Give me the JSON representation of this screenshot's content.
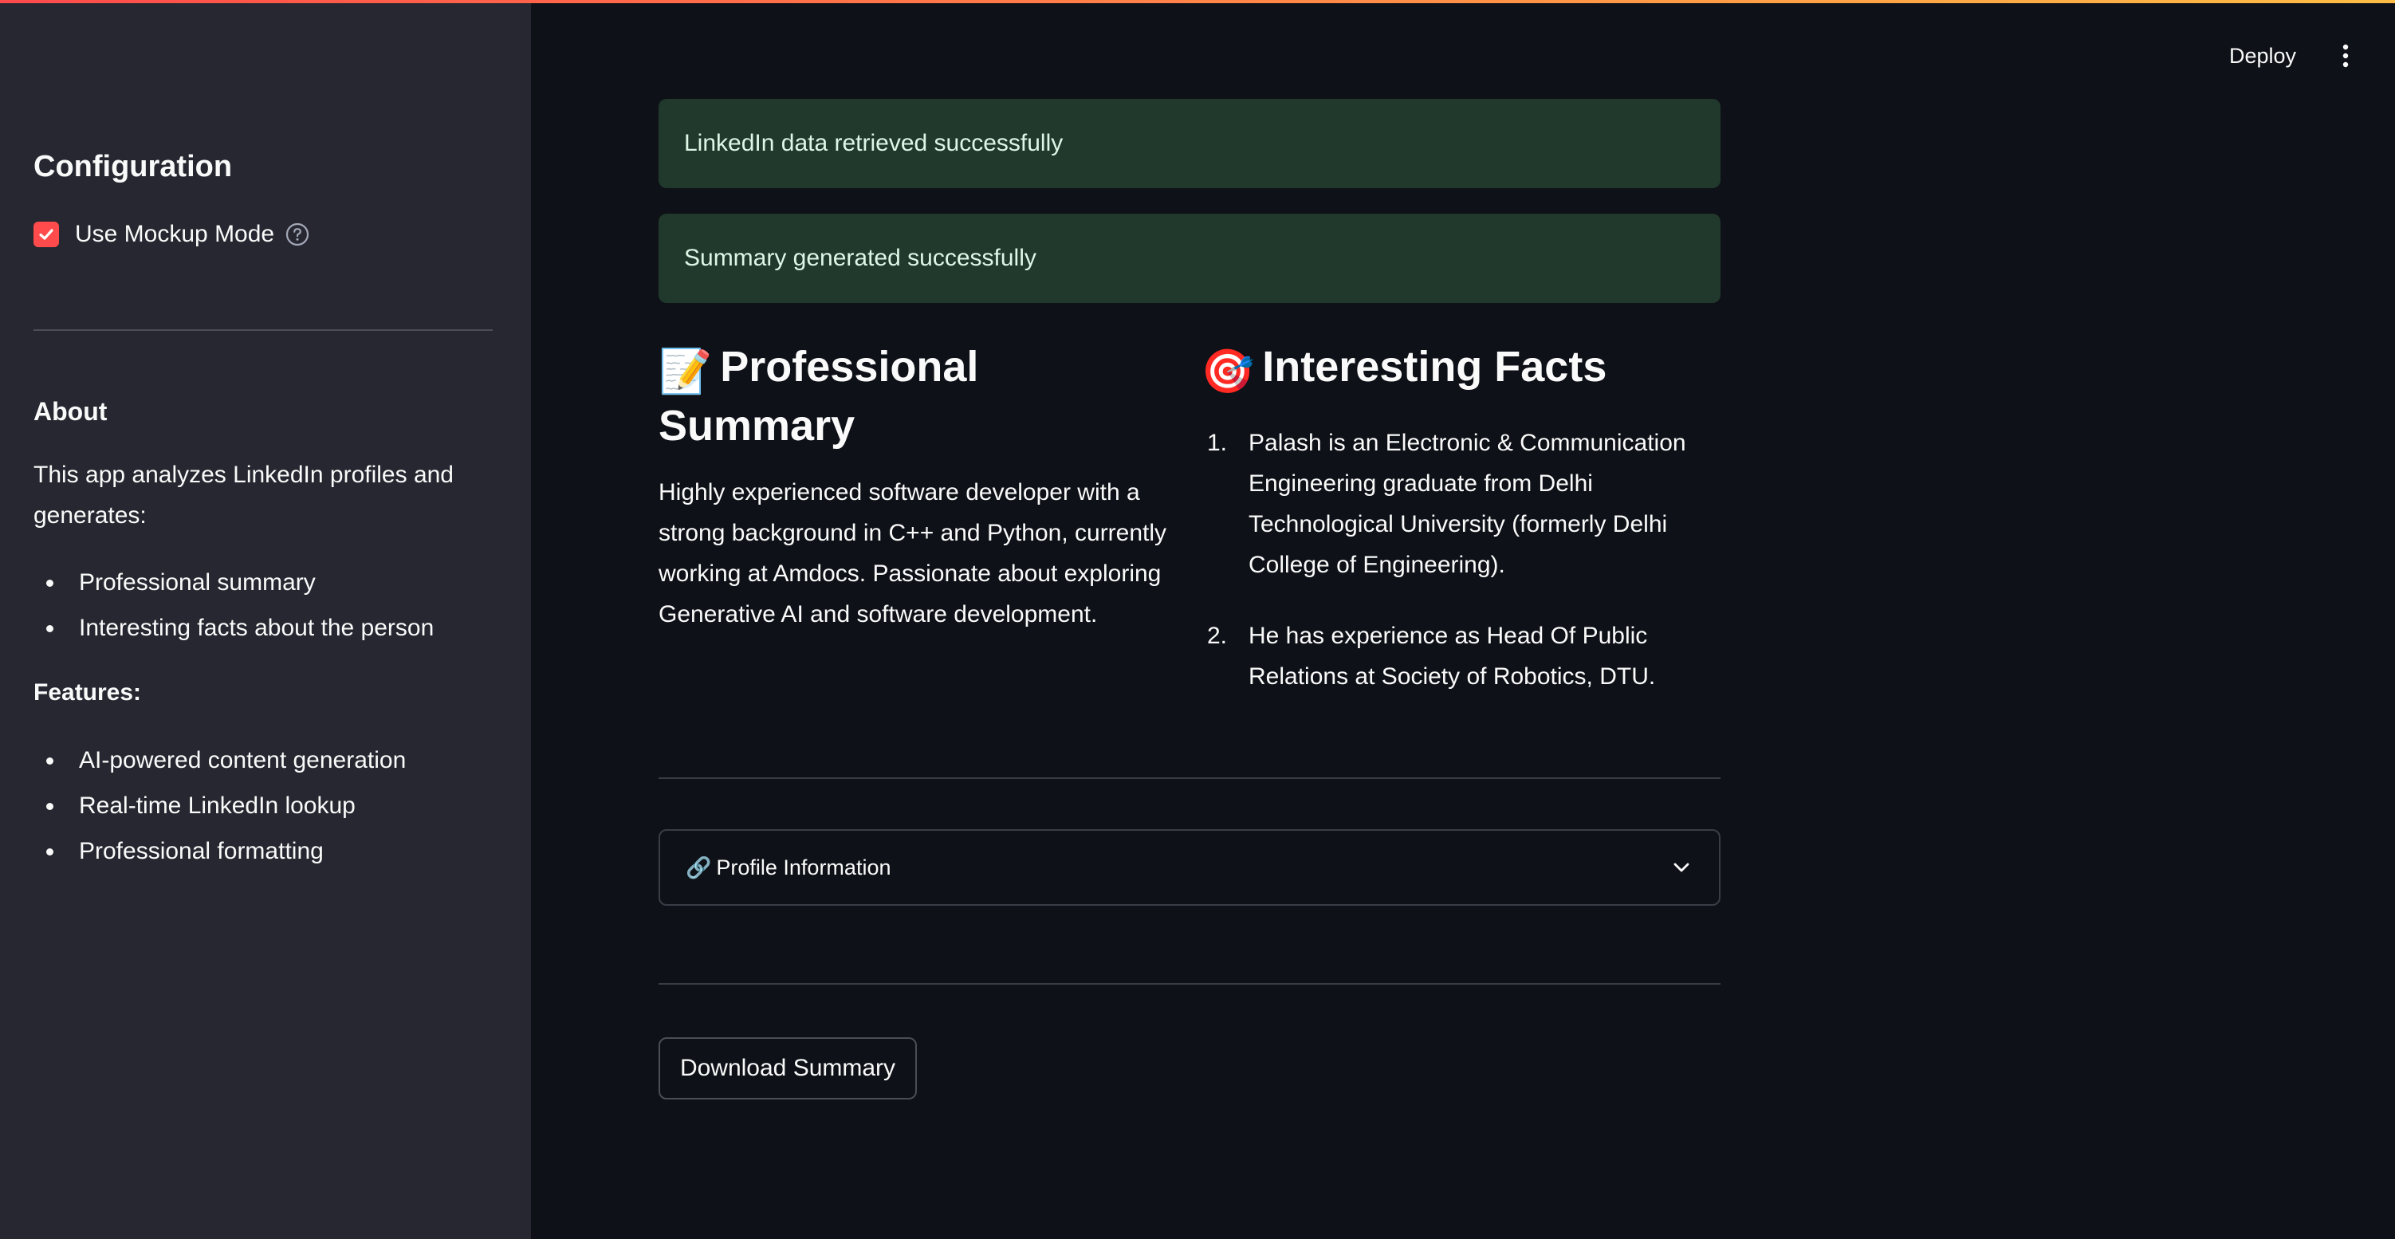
{
  "header": {
    "deploy_label": "Deploy"
  },
  "sidebar": {
    "title": "Configuration",
    "mockup_checkbox": {
      "label": "Use Mockup Mode",
      "checked": true
    },
    "about": {
      "title": "About",
      "description": "This app analyzes LinkedIn profiles and generates:",
      "items": [
        "Professional summary",
        "Interesting facts about the person"
      ]
    },
    "features": {
      "title": "Features:",
      "items": [
        "AI-powered content generation",
        "Real-time LinkedIn lookup",
        "Professional formatting"
      ]
    }
  },
  "main": {
    "alerts": [
      "LinkedIn data retrieved successfully",
      "Summary generated successfully"
    ],
    "summary": {
      "icon": "📝",
      "title": "Professional Summary",
      "text": "Highly experienced software developer with a strong background in C++ and Python, currently working at Amdocs. Passionate about exploring Generative AI and software development."
    },
    "facts": {
      "icon": "🎯",
      "title": "Interesting Facts",
      "items": [
        "Palash is an Electronic & Communication Engineering graduate from Delhi Technological University (formerly Delhi College of Engineering).",
        "He has experience as Head Of Public Relations at Society of Robotics, DTU."
      ]
    },
    "expander": {
      "icon": "🔗",
      "label": "Profile Information"
    },
    "download_label": "Download Summary"
  },
  "colors": {
    "accent": "#ff4b4b",
    "sidebar_bg": "#262730",
    "main_bg": "#0e1117",
    "success_bg": "#21382d"
  }
}
